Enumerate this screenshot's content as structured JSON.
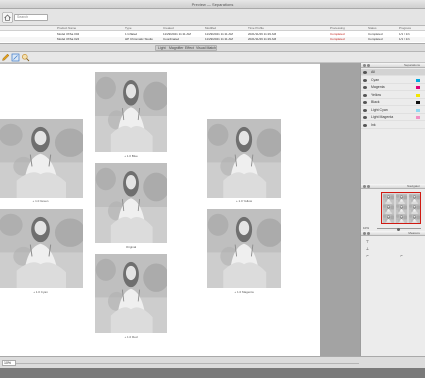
{
  "window": {
    "title": "Preview — Separations"
  },
  "search": {
    "placeholder": "Search"
  },
  "jobs": {
    "columns": [
      "",
      "Product Name",
      "Type",
      "Created",
      "Modified",
      "Time Profile",
      "",
      "",
      "",
      "",
      "Processing",
      "Status",
      "Progress"
    ],
    "rows": [
      [
        "",
        "Model 3XSa 004",
        "1 Inflated",
        "11/29/2021 11:11 AM",
        "11/29/2021 11:11 AM",
        "2021/11/29 11:29 AM",
        "",
        "",
        "",
        "",
        "Completed",
        "Completed",
        "1/1 / 1/1"
      ],
      [
        "",
        "Model 3XSa 024",
        "HP Chromatic Studio",
        "Coordinated",
        "11/29/2021 11:11 AM",
        "2021/11/29 11:29 AM",
        "",
        "",
        "",
        "",
        "Completed",
        "Completed",
        "1/1 / 1/1"
      ]
    ]
  },
  "view_tabs": [
    "Light",
    "Magnifier",
    "Effect",
    "Visual Match"
  ],
  "tools": [
    {
      "name": "pencil-icon",
      "color": "#e0a020"
    },
    {
      "name": "crop-icon",
      "color": "#3a78c8"
    },
    {
      "name": "magnify-icon",
      "color": "#c89030"
    }
  ],
  "images": [
    {
      "id": "original",
      "label": "Original"
    },
    {
      "id": "cyan",
      "label": "+ 1.0 Cyan"
    },
    {
      "id": "magenta",
      "label": "+ 1.0 Magenta"
    },
    {
      "id": "yellow",
      "label": "+ 1.0 Yellow"
    },
    {
      "id": "blue",
      "label": "+ 1.0 Blue"
    },
    {
      "id": "red",
      "label": "+ 1.0 Red"
    },
    {
      "id": "green",
      "label": "+ 1.0 Green"
    },
    {
      "id": "left-bottom",
      "label": "+ 1.0 Cyan"
    }
  ],
  "separations_panel": {
    "title": "Separations",
    "layers": [
      {
        "name": "All",
        "color": ""
      },
      {
        "name": "Cyan",
        "color": "#00a8e0"
      },
      {
        "name": "Magenta",
        "color": "#e0007a"
      },
      {
        "name": "Yellow",
        "color": "#f2e600"
      },
      {
        "name": "Black",
        "color": "#111111"
      },
      {
        "name": "Light Cyan",
        "color": "#8fd8f2"
      },
      {
        "name": "Light Magenta",
        "color": "#f28fc5"
      },
      {
        "name": "Ink",
        "color": ""
      }
    ]
  },
  "navigator_panel": {
    "title": "Navigator",
    "zoom": "10%"
  },
  "measure_panel": {
    "title": "Measure"
  },
  "status": {
    "zoom": "10%"
  },
  "colors": {
    "selection": "#d01a12",
    "panel": "#ececec"
  }
}
